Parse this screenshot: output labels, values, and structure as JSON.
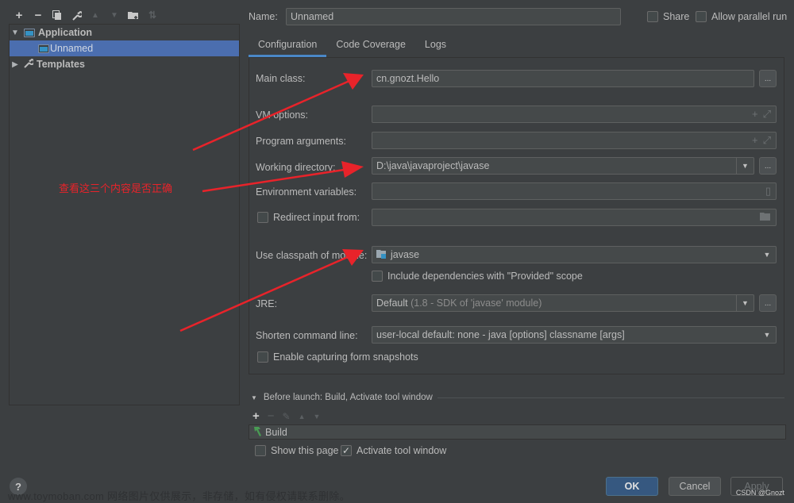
{
  "left_panel": {
    "toolbar": [
      {
        "name": "add",
        "glyph": "+"
      },
      {
        "name": "remove",
        "glyph": "−"
      },
      {
        "name": "copy",
        "glyph": "⧉"
      },
      {
        "name": "edit-defaults",
        "glyph": "🔧"
      },
      {
        "name": "move-up",
        "glyph": "▲"
      },
      {
        "name": "move-down",
        "glyph": "▼"
      },
      {
        "name": "new-folder",
        "glyph": "📁"
      },
      {
        "name": "sort",
        "glyph": "⇅"
      }
    ],
    "tree": {
      "application_label": "Application",
      "unnamed_label": "Unnamed",
      "templates_label": "Templates"
    },
    "help_label": "?"
  },
  "header": {
    "name_label": "Name:",
    "name_value": "Unnamed",
    "share_label": "Share",
    "share_checked": false,
    "allow_parallel_label": "Allow parallel run",
    "allow_parallel_checked": false
  },
  "tabs": [
    {
      "label": "Configuration",
      "active": true
    },
    {
      "label": "Code Coverage",
      "active": false
    },
    {
      "label": "Logs",
      "active": false
    }
  ],
  "config": {
    "main_class_label": "Main class:",
    "main_class_value": "cn.gnozt.Hello",
    "vm_options_label": "VM options:",
    "vm_options_value": "",
    "program_args_label": "Program arguments:",
    "program_args_value": "",
    "working_dir_label": "Working directory:",
    "working_dir_value": "D:\\java\\javaproject\\javase",
    "env_vars_label": "Environment variables:",
    "env_vars_value": "",
    "redirect_label": "Redirect input from:",
    "redirect_checked": false,
    "redirect_value": "",
    "classpath_label": "Use classpath of module:",
    "classpath_value": "javase",
    "include_provided_label": "Include dependencies with \"Provided\" scope",
    "include_provided_checked": false,
    "jre_label": "JRE:",
    "jre_value_main": "Default",
    "jre_value_detail": "(1.8 - SDK of 'javase' module)",
    "shorten_label": "Shorten command line:",
    "shorten_value": "user-local default: none - java [options] classname [args]",
    "capture_label": "Enable capturing form snapshots",
    "capture_checked": false,
    "ellipsis": "..."
  },
  "before_launch": {
    "header": "Before launch: Build, Activate tool window",
    "items": [
      "Build"
    ],
    "show_page_label": "Show this page",
    "show_page_checked": false,
    "activate_label": "Activate tool window",
    "activate_checked": true
  },
  "buttons": {
    "ok": "OK",
    "cancel": "Cancel",
    "apply": "Apply"
  },
  "annotation": {
    "text": "查看这三个内容是否正确",
    "color": "#e8232a"
  },
  "watermark": "www.toymoban.com 网络图片仅供展示，非存储，如有侵权请联系删除。",
  "credit": "CSDN @Gnozt",
  "colors": {
    "background": "#3c3f41",
    "selection": "#4b6eaf",
    "accent_tab": "#4a88c7",
    "ok_button": "#365880"
  }
}
